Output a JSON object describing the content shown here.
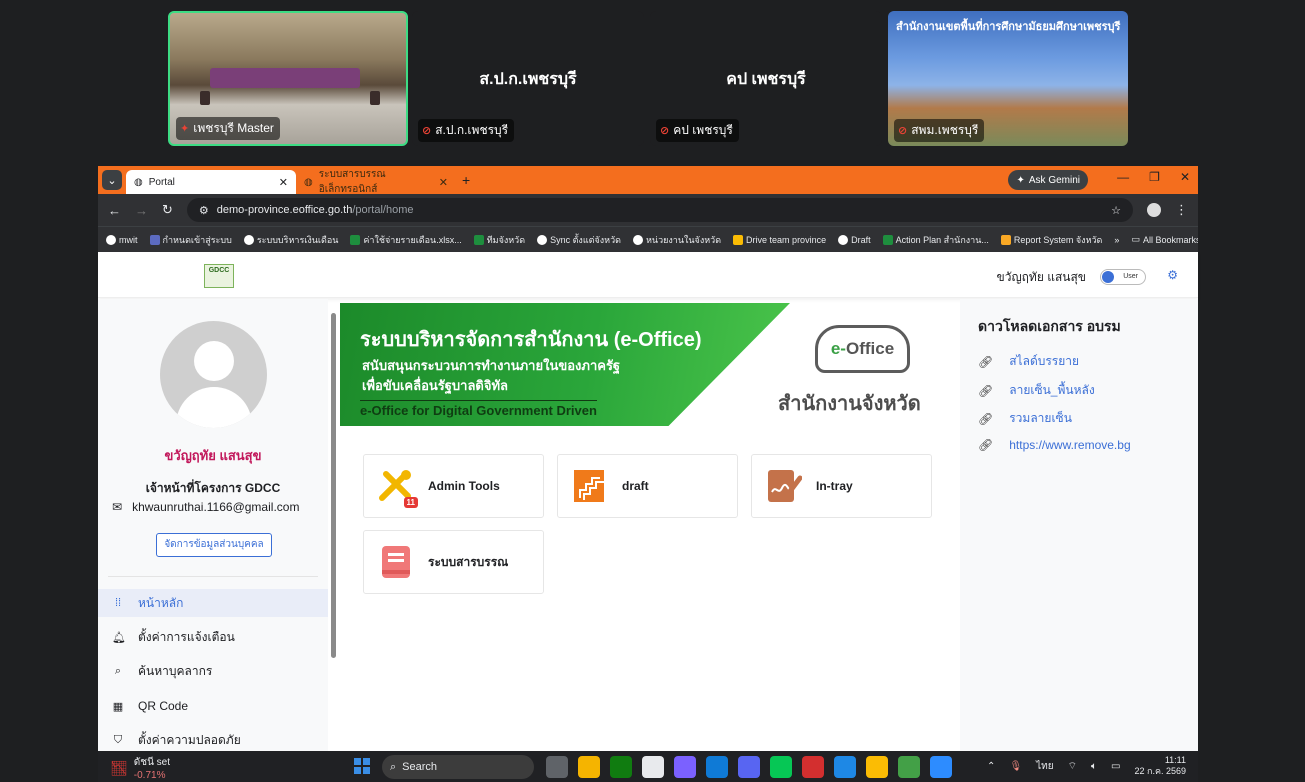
{
  "meeting": {
    "tiles": [
      {
        "label": "เพชรบุรี Master",
        "center": ""
      },
      {
        "label": "ส.ป.ก.เพชรบุรี",
        "center": "ส.ป.ก.เพชรบุรี"
      },
      {
        "label": "คป เพชรบุรี",
        "center": "คป เพชรบุรี"
      },
      {
        "label": "สพม.เพชรบุรี",
        "center": "",
        "header": "สำนักงานเขตพื้นที่การศึกษามัธยมศึกษาเพชรบุรี"
      }
    ]
  },
  "browser": {
    "tabs": [
      {
        "title": "Portal",
        "active": true
      },
      {
        "title": "ระบบสารบรรณอิเล็กทรอนิกส์",
        "active": false
      }
    ],
    "ask_gemini": "Ask Gemini",
    "url_host": "demo-province.eoffice.go.th",
    "url_path": "/portal/home",
    "bookmarks": [
      "mwit",
      "กำหนดเข้าสู่ระบบ",
      "ระบบบริหารเงินเดือน",
      "ค่าใช้จ่ายรายเดือน.xlsx...",
      "ทีมจังหวัด",
      "Sync ตั้งแต่จังหวัด",
      "หน่วยงานในจังหวัด",
      "Drive team province",
      "Draft",
      "Action Plan สำนักงาน...",
      "Report System จังหวัด"
    ],
    "all_bookmarks": "All Bookmarks"
  },
  "header": {
    "logo_text": "GDCC",
    "user_name": "ขวัญฤทัย แสนสุข",
    "toggle_label": "User"
  },
  "profile": {
    "name": "ขวัญฤทัย แสนสุข",
    "role": "เจ้าหน้าที่โครงการ GDCC",
    "email": "khwaunruthai.1166@gmail.com",
    "manage_button": "จัดการข้อมูลส่วนบุคคล"
  },
  "nav": [
    {
      "label": "หน้าหลัก",
      "icon": "grid-icon",
      "active": true
    },
    {
      "label": "ตั้งค่าการแจ้งเตือน",
      "icon": "bell-icon",
      "active": false
    },
    {
      "label": "ค้นหาบุคลากร",
      "icon": "search-icon",
      "active": false
    },
    {
      "label": "QR Code",
      "icon": "qr-code-icon",
      "active": false
    },
    {
      "label": "ตั้งค่าความปลอดภัย",
      "icon": "shield-icon",
      "active": false
    }
  ],
  "banner": {
    "title": "ระบบบริหารจัดการสำนักงาน (e-Office)",
    "line1": "สนับสนุนกระบวนการทำงานภายในของภาครัฐ",
    "line2": "เพื่อขับเคลื่อนรัฐบาลดิจิทัล",
    "tagline": "e-Office for Digital Government Driven",
    "logo_prefix": "e-",
    "logo_word": "Office",
    "org": "สำนักงานจังหวัด"
  },
  "apps": [
    {
      "label": "Admin Tools",
      "badge": "11"
    },
    {
      "label": "draft"
    },
    {
      "label": "In-tray"
    },
    {
      "label": "ระบบสารบรรณ"
    }
  ],
  "downloads": {
    "title": "ดาวโหลดเอกสาร อบรม",
    "links": [
      "สไลด์บรรยาย",
      "ลายเซ็น_พื้นหลัง",
      "รวมลายเซ็น",
      "https://www.remove.bg"
    ]
  },
  "taskbar": {
    "stock_name": "ดัชนี set",
    "stock_change": "-0.71%",
    "search": "Search",
    "lang": "ไทย",
    "time": "11:11",
    "date": "22 ก.ค. 2569"
  },
  "colors": {
    "accent": "#3b6fd6",
    "tabbar": "#f46e1e",
    "name": "#c2185b",
    "banner_green": "#2aa63a"
  }
}
